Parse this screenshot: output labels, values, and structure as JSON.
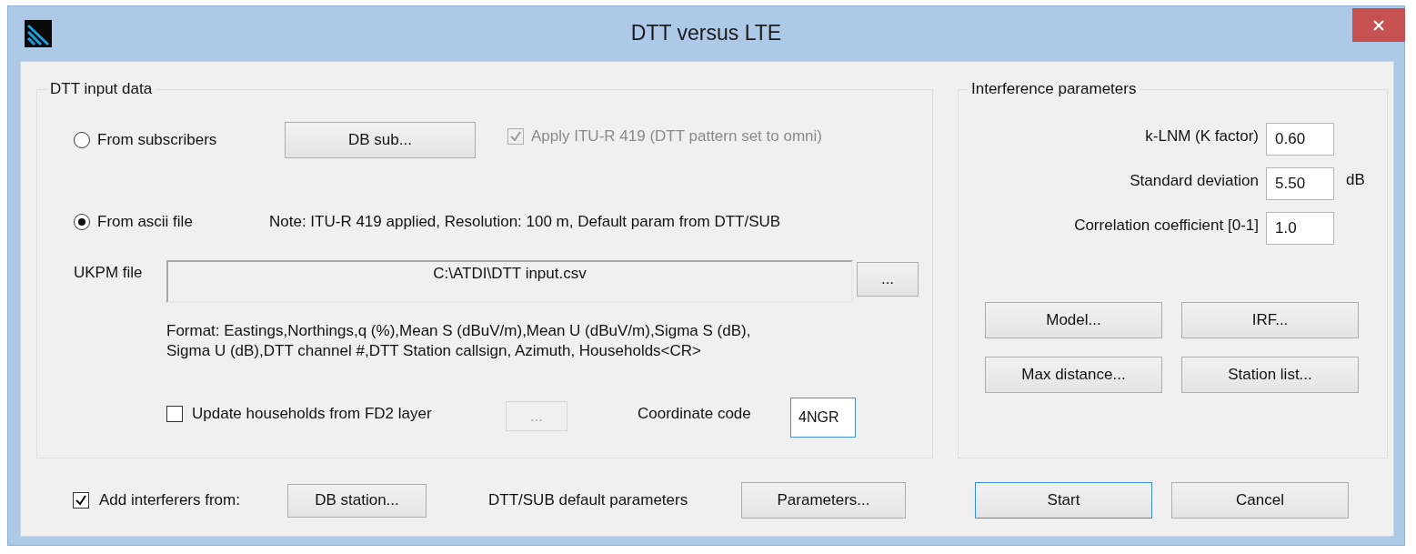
{
  "window": {
    "title": "DTT versus LTE"
  },
  "dtt_input": {
    "title": "DTT input data",
    "sources": [
      {
        "label": "From subscribers",
        "selected": false
      },
      {
        "label": "From ascii file",
        "selected": true
      }
    ],
    "db_sub_button": "DB sub...",
    "apply_itu": {
      "label": "Apply ITU-R 419 (DTT pattern set to omni)",
      "checked": true,
      "disabled": true
    },
    "note": "Note: ITU-R 419 applied, Resolution: 100 m, Default param from DTT/SUB",
    "ukpm": {
      "label": "UKPM file",
      "value": "C:\\ATDI\\DTT input.csv",
      "browse": "..."
    },
    "format": [
      "Format: Eastings,Northings,q (%),Mean S (dBuV/m),Mean U (dBuV/m),Sigma S (dB),",
      "Sigma U (dB),DTT channel #,DTT Station callsign, Azimuth, Households<CR>"
    ],
    "update_households": {
      "label": "Update households from FD2 layer",
      "checked": false
    },
    "fd2_browse": {
      "label": "...",
      "disabled": true
    },
    "coordinate": {
      "label": "Coordinate code",
      "value": "4NGR"
    }
  },
  "interference": {
    "title": "Interference parameters",
    "params": [
      {
        "label": "k-LNM (K factor)",
        "value": "0.60"
      },
      {
        "label": "Standard deviation",
        "value": "5.50",
        "unit": "dB"
      },
      {
        "label": "Correlation coefficient [0-1]",
        "value": "1.0"
      }
    ],
    "buttons": [
      "Model...",
      "IRF...",
      "Max distance...",
      "Station list..."
    ]
  },
  "bottom": {
    "add_interferers": {
      "label": "Add interferers from:",
      "checked": true
    },
    "db_station": "DB station...",
    "defaults_label": "DTT/SUB default parameters",
    "parameters": "Parameters...",
    "actions": [
      {
        "label": "Start",
        "focused": true
      },
      {
        "label": "Cancel",
        "focused": false
      }
    ]
  }
}
